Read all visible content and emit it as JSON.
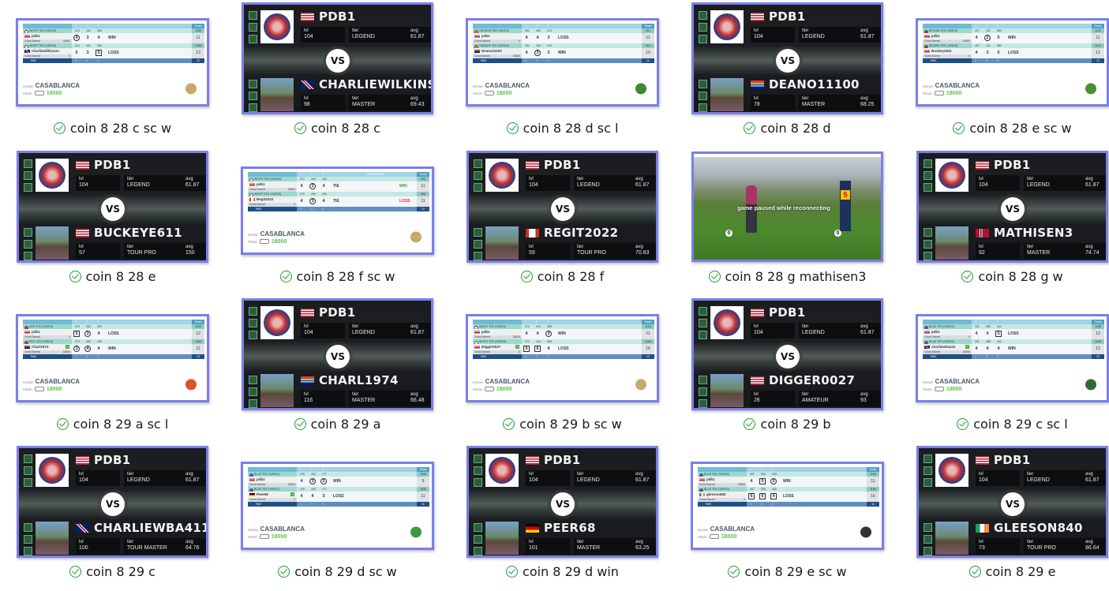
{
  "files": [
    {
      "caption": "coin 8 28 c sc w",
      "kind": "scorecard",
      "status": "synced",
      "tee": "WHITE TEE (YARDS)",
      "tee_color": "#ffffff",
      "holes": [
        "1",
        "2",
        "3"
      ],
      "yards": [
        "514",
        "161",
        "383"
      ],
      "yards_total": "1058",
      "room_label": "ROOM:",
      "room": "CASABLANCA",
      "prize_label": "PRIZE:",
      "prize": "18000",
      "totals_label": "Totals",
      "par_label": "PAR",
      "par": [
        "5",
        "3",
        "4"
      ],
      "par_total": "12",
      "coins_label": "Coins Earned",
      "logo": "crossed-clubs-crest",
      "players": [
        {
          "name": "pdb1",
          "flag": "us",
          "scores": [
            {
              "v": "4",
              "mark": "circle"
            },
            {
              "v": "3"
            },
            {
              "v": "4"
            }
          ],
          "result": "WIN",
          "total": "11",
          "coins": "18000"
        },
        {
          "name": "charliewilkinson",
          "flag": "gb",
          "scores": [
            {
              "v": "5"
            },
            {
              "v": "3"
            },
            {
              "v": "5",
              "mark": "box"
            }
          ],
          "result": "LOSS",
          "total": "13",
          "coins": "0"
        }
      ]
    },
    {
      "caption": "coin 8 28 c",
      "kind": "versus",
      "status": "synced",
      "me": {
        "name": "PDB1",
        "flag": "us",
        "lvl": "104",
        "tier": "LEGEND",
        "avg": "61.87"
      },
      "opp": {
        "name": "CHARLIEWILKINSON",
        "flag": "gb",
        "lvl": "98",
        "tier": "MASTER",
        "avg": "69.43"
      },
      "labels": {
        "lvl": "lvl",
        "tier": "tier",
        "avg": "avg",
        "vs": "VS"
      }
    },
    {
      "caption": "coin 8 28 d sc l",
      "kind": "scorecard",
      "status": "synced",
      "tee": "ORANGE TEE (YARDS)",
      "tee_color": "#e58b2c",
      "holes": [
        "1",
        "2",
        "3"
      ],
      "yards": [
        "351",
        "400",
        "210"
      ],
      "yards_total": "961",
      "room_label": "ROOM:",
      "room": "CASABLANCA",
      "prize_label": "PRIZE:",
      "prize": "18000",
      "totals_label": "Totals",
      "par_label": "PAR",
      "par": [
        "4",
        "4",
        "3"
      ],
      "par_total": "11",
      "coins_label": "Coins Earned",
      "logo": "tree-with-flag",
      "players": [
        {
          "name": "pdb1",
          "flag": "us",
          "scores": [
            {
              "v": "4"
            },
            {
              "v": "4"
            },
            {
              "v": "3"
            }
          ],
          "result": "LOSS",
          "total": "11",
          "coins": "0"
        },
        {
          "name": "Deano11100",
          "flag": "za",
          "scores": [
            {
              "v": "4"
            },
            {
              "v": "3",
              "mark": "circle"
            },
            {
              "v": "3"
            }
          ],
          "result": "WIN",
          "total": "10",
          "coins": "18000"
        }
      ]
    },
    {
      "caption": "coin 8 28 d",
      "kind": "versus",
      "status": "synced",
      "me": {
        "name": "PDB1",
        "flag": "us",
        "lvl": "104",
        "tier": "LEGEND",
        "avg": "61.87"
      },
      "opp": {
        "name": "DEANO11100",
        "flag": "za",
        "lvl": "78",
        "tier": "MASTER",
        "avg": "68.25"
      },
      "labels": {
        "lvl": "lvl",
        "tier": "tier",
        "avg": "avg",
        "vs": "VS"
      }
    },
    {
      "caption": "coin 8 28 e sc w",
      "kind": "scorecard",
      "status": "synced",
      "tee": "BROWN TEE (YARDS)",
      "tee_color": "#8a5a2b",
      "holes": [
        "1",
        "2",
        "3"
      ],
      "yards": [
        "407",
        "151",
        "583"
      ],
      "yards_total": "1141",
      "room_label": "ROOM:",
      "room": "CASABLANCA",
      "prize_label": "PRIZE:",
      "prize": "18000",
      "totals_label": "Totals",
      "par_label": "PAR",
      "par": [
        "4",
        "3",
        "5"
      ],
      "par_total": "12",
      "coins_label": "Coins Earned",
      "logo": "trees-script-crest",
      "players": [
        {
          "name": "pdb1",
          "flag": "us",
          "scores": [
            {
              "v": "4"
            },
            {
              "v": "2",
              "mark": "circle"
            },
            {
              "v": "5"
            }
          ],
          "result": "WIN",
          "total": "11",
          "coins": "18000"
        },
        {
          "name": "Buckeye611",
          "flag": "us",
          "scores": [
            {
              "v": "4"
            },
            {
              "v": "3"
            },
            {
              "v": "5"
            }
          ],
          "result": "LOSS",
          "total": "12",
          "coins": "0"
        }
      ]
    },
    {
      "caption": "coin 8 28 e",
      "kind": "versus",
      "status": "synced",
      "me": {
        "name": "PDB1",
        "flag": "us",
        "lvl": "104",
        "tier": "LEGEND",
        "avg": "61.87"
      },
      "opp": {
        "name": "BUCKEYE611",
        "flag": "us",
        "lvl": "57",
        "tier": "TOUR PRO",
        "avg": "150"
      },
      "labels": {
        "lvl": "lvl",
        "tier": "tier",
        "avg": "avg",
        "vs": "VS"
      }
    },
    {
      "caption": "coin 8 28 f sc w",
      "kind": "scorecard",
      "status": "synced",
      "tee": "WHITE TEE (YARDS)",
      "tee_color": "#ffffff",
      "holes": [
        "1",
        "2",
        "3"
      ],
      "yards": [
        "372",
        "294",
        "330"
      ],
      "yards_total": "996",
      "room_label": "ROOM:",
      "room": "CASABLANCA",
      "prize_label": "PRIZE:",
      "prize": "18000",
      "totals_label": "Totals",
      "par_label": "PAR",
      "par": [
        "4",
        "4",
        "4"
      ],
      "par_total": "12",
      "coins_label": "Coins Earned",
      "logo": "crossed-clubs-crest",
      "tiebreaker_label": "TIEBREAKER",
      "players": [
        {
          "name": "pdb1",
          "flag": "us",
          "scores": [
            {
              "v": "4"
            },
            {
              "v": "3",
              "mark": "circle"
            },
            {
              "v": "4"
            }
          ],
          "result": "TIE",
          "tiebreak": "WIN",
          "total": "11",
          "coins": "18000"
        },
        {
          "name": "Regit2022",
          "flag": "ca",
          "scores": [
            {
              "v": "4"
            },
            {
              "v": "3",
              "mark": "circle"
            },
            {
              "v": "4"
            }
          ],
          "result": "TIE",
          "tiebreak": "LOSS",
          "total": "11",
          "coins": "0"
        }
      ]
    },
    {
      "caption": "coin 8 28 f",
      "kind": "versus",
      "status": "synced",
      "me": {
        "name": "PDB1",
        "flag": "us",
        "lvl": "104",
        "tier": "LEGEND",
        "avg": "61.87"
      },
      "opp": {
        "name": "REGIT2022",
        "flag": "ca",
        "lvl": "59",
        "tier": "TOUR PRO",
        "avg": "70.83"
      },
      "labels": {
        "lvl": "lvl",
        "tier": "tier",
        "avg": "avg",
        "vs": "VS"
      }
    },
    {
      "caption": "coin 8 28 g mathisen3",
      "kind": "game",
      "status": "synced",
      "message": "game paused while reconnecting",
      "hole": "5"
    },
    {
      "caption": "coin 8 28 g w",
      "kind": "versus",
      "status": "synced",
      "me": {
        "name": "PDB1",
        "flag": "us",
        "lvl": "104",
        "tier": "LEGEND",
        "avg": "61.87"
      },
      "opp": {
        "name": "MATHISEN3",
        "flag": "no",
        "lvl": "92",
        "tier": "MASTER",
        "avg": "74.74"
      },
      "labels": {
        "lvl": "lvl",
        "tier": "tier",
        "avg": "avg",
        "vs": "VS"
      }
    },
    {
      "caption": "coin 8 29 a sc l",
      "kind": "scorecard",
      "status": "synced",
      "tee": "RED TEE (YARDS)",
      "tee_color": "#d9302c",
      "holes": [
        "1",
        "2",
        "3"
      ],
      "yards": [
        "370",
        "530",
        "409"
      ],
      "yards_total": "1309",
      "room_label": "ROOM:",
      "room": "CASABLANCA",
      "prize_label": "PRIZE:",
      "prize": "18000",
      "totals_label": "Totals",
      "par_label": "PAR",
      "par": [
        "4",
        "5",
        "4"
      ],
      "par_total": "13",
      "coins_label": "Coins Earned",
      "logo": "red-royal-crest",
      "players": [
        {
          "name": "pdb1",
          "flag": "us",
          "scores": [
            {
              "v": "5",
              "mark": "box"
            },
            {
              "v": "3",
              "mark": "circle"
            },
            {
              "v": "4"
            }
          ],
          "result": "LOSS",
          "total": "12",
          "coins": "0"
        },
        {
          "name": "Charl1974",
          "flag": "za",
          "plus": true,
          "scores": [
            {
              "v": "3",
              "mark": "circle"
            },
            {
              "v": "4",
              "mark": "circle"
            },
            {
              "v": "4"
            }
          ],
          "result": "WIN",
          "total": "11",
          "coins": "18000"
        }
      ]
    },
    {
      "caption": "coin 8 29 a",
      "kind": "versus",
      "status": "synced",
      "me": {
        "name": "PDB1",
        "flag": "us",
        "lvl": "104",
        "tier": "LEGEND",
        "avg": "61.87"
      },
      "opp": {
        "name": "CHARL1974",
        "flag": "za",
        "lvl": "116",
        "tier": "MASTER",
        "avg": "66.48"
      },
      "labels": {
        "lvl": "lvl",
        "tier": "tier",
        "avg": "avg",
        "vs": "VS"
      }
    },
    {
      "caption": "coin 8 29 b sc w",
      "kind": "scorecard",
      "status": "synced",
      "tee": "WHITE TEE (YARDS)",
      "tee_color": "#ffffff",
      "holes": [
        "1",
        "2",
        "3"
      ],
      "yards": [
        "372",
        "410",
        "383"
      ],
      "yards_total": "1165",
      "room_label": "ROOM:",
      "room": "CASABLANCA",
      "prize_label": "PRIZE:",
      "prize": "18000",
      "totals_label": "Totals",
      "par_label": "PAR",
      "par": [
        "4",
        "4",
        "4"
      ],
      "par_total": "12",
      "coins_label": "Coins Earned",
      "logo": "crossed-clubs-crest",
      "players": [
        {
          "name": "pdb1",
          "flag": "us",
          "scores": [
            {
              "v": "4"
            },
            {
              "v": "4"
            },
            {
              "v": "3",
              "mark": "circle"
            }
          ],
          "result": "WIN",
          "total": "11",
          "coins": "18000"
        },
        {
          "name": "Digger0027",
          "flag": "us",
          "plus": true,
          "scores": [
            {
              "v": "6",
              "mark": "box"
            },
            {
              "v": "6",
              "mark": "box"
            },
            {
              "v": "4"
            }
          ],
          "result": "LOSS",
          "total": "16",
          "coins": "0"
        }
      ]
    },
    {
      "caption": "coin 8 29 b",
      "kind": "versus",
      "status": "synced",
      "me": {
        "name": "PDB1",
        "flag": "us",
        "lvl": "104",
        "tier": "LEGEND",
        "avg": "61.87"
      },
      "opp": {
        "name": "DIGGER0027",
        "flag": "us",
        "lvl": "26",
        "tier": "AMATEUR",
        "avg": "93"
      },
      "labels": {
        "lvl": "lvl",
        "tier": "tier",
        "avg": "avg",
        "vs": "VS"
      }
    },
    {
      "caption": "coin 8 29 c sc l",
      "kind": "scorecard",
      "status": "synced",
      "tee": "BLUE TEE (YARDS)",
      "tee_color": "#2f6fc4",
      "holes": [
        "1",
        "2",
        "3"
      ],
      "yards": [
        "331",
        "485",
        "442"
      ],
      "yards_total": "1258",
      "room_label": "ROOM:",
      "room": "CASABLANCA",
      "prize_label": "PRIZE:",
      "prize": "18000",
      "totals_label": "Totals",
      "par_label": "PAR",
      "par": [
        "4",
        "4",
        "4"
      ],
      "par_total": "12",
      "coins_label": "Coins Earned",
      "logo": "cc-monogram",
      "players": [
        {
          "name": "pdb1",
          "flag": "us",
          "scores": [
            {
              "v": "4"
            },
            {
              "v": "4"
            },
            {
              "v": "5",
              "mark": "box"
            }
          ],
          "result": "LOSS",
          "total": "13",
          "coins": "0"
        },
        {
          "name": "charliewba411",
          "flag": "gb",
          "plus": true,
          "scores": [
            {
              "v": "4"
            },
            {
              "v": "4"
            },
            {
              "v": "4"
            }
          ],
          "result": "WIN",
          "total": "12",
          "coins": "18000"
        }
      ]
    },
    {
      "caption": "coin 8 29 c",
      "kind": "versus",
      "status": "synced",
      "me": {
        "name": "PDB1",
        "flag": "us",
        "lvl": "104",
        "tier": "LEGEND",
        "avg": "61.87"
      },
      "opp": {
        "name": "CHARLIEWBA411",
        "flag": "gb",
        "lvl": "100",
        "tier": "TOUR MASTER",
        "avg": "64.76"
      },
      "labels": {
        "lvl": "lvl",
        "tier": "tier",
        "avg": "avg",
        "vs": "VS"
      }
    },
    {
      "caption": "coin 8 29 d sc w",
      "kind": "scorecard",
      "status": "synced",
      "tee": "BLUE TEE (YARDS)",
      "tee_color": "#2f6fc4",
      "holes": [
        "1",
        "2",
        "3"
      ],
      "yards": [
        "476",
        "403",
        "177"
      ],
      "yards_total": "1056",
      "room_label": "ROOM:",
      "room": "CASABLANCA",
      "prize_label": "PRIZE:",
      "prize": "18000",
      "totals_label": "Totals",
      "par_label": "PAR",
      "par": [
        "4",
        "4",
        "3"
      ],
      "par_total": "11",
      "coins_label": "Coins Earned",
      "logo": "shamrock-crest",
      "players": [
        {
          "name": "pdb1",
          "flag": "us",
          "scores": [
            {
              "v": "4"
            },
            {
              "v": "3",
              "mark": "circle"
            },
            {
              "v": "2",
              "mark": "circle"
            }
          ],
          "result": "WIN",
          "total": "9",
          "coins": "18000"
        },
        {
          "name": "Peer68",
          "flag": "de",
          "plus": true,
          "scores": [
            {
              "v": "4"
            },
            {
              "v": "4"
            },
            {
              "v": "3"
            }
          ],
          "result": "LOSS",
          "total": "11",
          "coins": "0"
        }
      ]
    },
    {
      "caption": "coin 8 29 d win",
      "kind": "versus",
      "status": "synced",
      "me": {
        "name": "PDB1",
        "flag": "us",
        "lvl": "104",
        "tier": "LEGEND",
        "avg": "61.87"
      },
      "opp": {
        "name": "PEER68",
        "flag": "de",
        "lvl": "101",
        "tier": "MASTER",
        "avg": "63.25"
      },
      "labels": {
        "lvl": "lvl",
        "tier": "tier",
        "avg": "avg",
        "vs": "VS"
      }
    },
    {
      "caption": "coin 8 29 e sc w",
      "kind": "scorecard",
      "status": "synced",
      "tee": "BLUE TEE (YARDS)",
      "tee_color": "#2f6fc4",
      "holes": [
        "1",
        "2",
        "3"
      ],
      "yards": [
        "467",
        "535",
        "183"
      ],
      "yards_total": "1185",
      "room_label": "ROOM:",
      "room": "CASABLANCA",
      "prize_label": "PRIZE:",
      "prize": "18000",
      "totals_label": "Totals",
      "par_label": "PAR",
      "par": [
        "4",
        "4",
        "3"
      ],
      "par_total": "11",
      "coins_label": "Coins Earned",
      "logo": "golfer-1895-crest",
      "players": [
        {
          "name": "pdb1",
          "flag": "us",
          "scores": [
            {
              "v": "4"
            },
            {
              "v": "5",
              "mark": "box"
            },
            {
              "v": "2",
              "mark": "circle"
            }
          ],
          "result": "WIN",
          "total": "11",
          "coins": "18000"
        },
        {
          "name": "gleeson840",
          "flag": "ie",
          "scores": [
            {
              "v": "6",
              "mark": "box"
            },
            {
              "v": "6",
              "mark": "box"
            },
            {
              "v": "4",
              "mark": "box"
            }
          ],
          "result": "LOSS",
          "total": "16",
          "coins": "0"
        }
      ]
    },
    {
      "caption": "coin 8 29 e",
      "kind": "versus",
      "status": "synced",
      "me": {
        "name": "PDB1",
        "flag": "us",
        "lvl": "104",
        "tier": "LEGEND",
        "avg": "61.87"
      },
      "opp": {
        "name": "GLEESON840",
        "flag": "ie",
        "lvl": "73",
        "tier": "TOUR PRO",
        "avg": "86.64"
      },
      "labels": {
        "lvl": "lvl",
        "tier": "tier",
        "avg": "avg",
        "vs": "VS"
      }
    }
  ],
  "colors": {
    "selection_border": "#7b7fe8",
    "sync_check": "#1f9d3a",
    "prize_green": "#5cbf4a",
    "par_row": "#1f4f8a"
  }
}
